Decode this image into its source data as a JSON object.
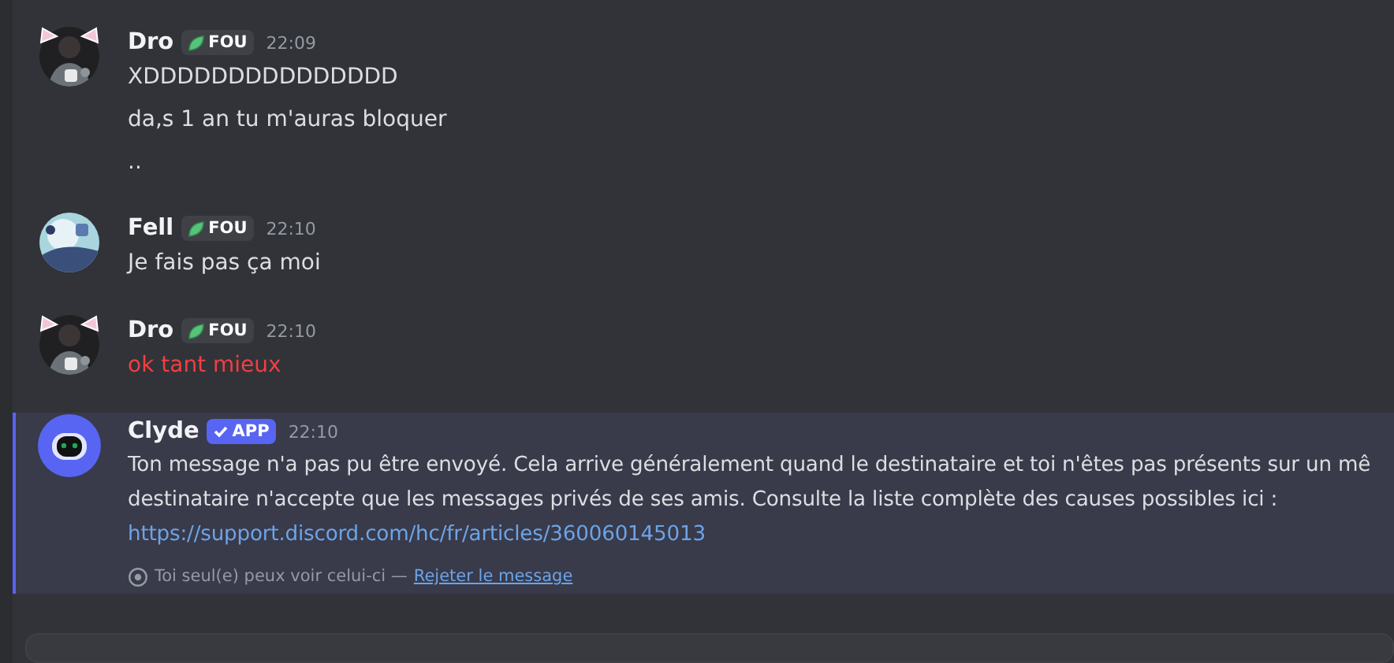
{
  "messages": [
    {
      "kind": "user",
      "author": "Dro",
      "avatar": {
        "kind": "picture",
        "decoration": true
      },
      "badge": {
        "kind": "tag",
        "label": "FOU"
      },
      "time": "22:09",
      "lines": [
        {
          "kind": "text",
          "text": "XDDDDDDDDDDDDDDD",
          "failed": false
        },
        {
          "kind": "text",
          "text": "da,s 1 an tu m'auras bloquer",
          "failed": false
        },
        {
          "kind": "text",
          "text": "..",
          "failed": false
        }
      ]
    },
    {
      "kind": "user",
      "author": "Fell",
      "avatar": {
        "kind": "picture",
        "decoration": false
      },
      "badge": {
        "kind": "tag",
        "label": "FOU"
      },
      "time": "22:10",
      "lines": [
        {
          "kind": "text",
          "text": "Je fais pas ça moi",
          "failed": false
        }
      ]
    },
    {
      "kind": "user",
      "author": "Dro",
      "avatar": {
        "kind": "picture",
        "decoration": true
      },
      "badge": {
        "kind": "tag",
        "label": "FOU"
      },
      "time": "22:10",
      "lines": [
        {
          "kind": "text",
          "text": "ok tant mieux",
          "failed": true
        }
      ]
    },
    {
      "kind": "ephemeral",
      "author": "Clyde",
      "avatar": {
        "kind": "bot",
        "decoration": false
      },
      "badge": {
        "kind": "app",
        "label": "APP"
      },
      "time": "22:10",
      "lines": [
        {
          "kind": "text",
          "text": "Ton message n'a pas pu être envoyé. Cela arrive généralement quand le destinataire et toi n'êtes pas présents sur un mê",
          "failed": false
        },
        {
          "kind": "text",
          "text": "destinataire n'accepte que les messages privés de ses amis. Consulte la liste complète des causes possibles ici :",
          "failed": false
        },
        {
          "kind": "link",
          "text": "https://support.discord.com/hc/fr/articles/360060145013",
          "failed": false
        }
      ],
      "footer": {
        "note": "Toi seul(e) peux voir celui-ci —",
        "action": "Rejeter le message"
      }
    }
  ],
  "composer": {
    "kind": "field"
  }
}
